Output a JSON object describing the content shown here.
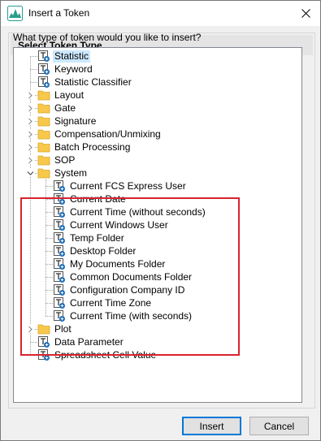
{
  "window": {
    "title": "Insert a Token"
  },
  "group": {
    "header": "Select Token Type",
    "question": "What type of token would you like to insert?"
  },
  "tree": {
    "items": [
      {
        "label": "Statistic",
        "kind": "token",
        "level": 0,
        "selected": true
      },
      {
        "label": "Keyword",
        "kind": "token",
        "level": 0
      },
      {
        "label": "Statistic Classifier",
        "kind": "token",
        "level": 0
      },
      {
        "label": "Layout",
        "kind": "folder",
        "level": 0,
        "expanded": false
      },
      {
        "label": "Gate",
        "kind": "folder",
        "level": 0,
        "expanded": false
      },
      {
        "label": "Signature",
        "kind": "folder",
        "level": 0,
        "expanded": false
      },
      {
        "label": "Compensation/Unmixing",
        "kind": "folder",
        "level": 0,
        "expanded": false
      },
      {
        "label": "Batch Processing",
        "kind": "folder",
        "level": 0,
        "expanded": false
      },
      {
        "label": "SOP",
        "kind": "folder",
        "level": 0,
        "expanded": false
      },
      {
        "label": "System",
        "kind": "folder",
        "level": 0,
        "expanded": true
      },
      {
        "label": "Current FCS Express User",
        "kind": "token",
        "level": 1
      },
      {
        "label": "Current Date",
        "kind": "token",
        "level": 1
      },
      {
        "label": "Current Time (without seconds)",
        "kind": "token",
        "level": 1
      },
      {
        "label": "Current Windows User",
        "kind": "token",
        "level": 1
      },
      {
        "label": "Temp Folder",
        "kind": "token",
        "level": 1
      },
      {
        "label": "Desktop Folder",
        "kind": "token",
        "level": 1
      },
      {
        "label": "My Documents Folder",
        "kind": "token",
        "level": 1
      },
      {
        "label": "Common Documents Folder",
        "kind": "token",
        "level": 1
      },
      {
        "label": "Configuration Company ID",
        "kind": "token",
        "level": 1
      },
      {
        "label": "Current Time Zone",
        "kind": "token",
        "level": 1
      },
      {
        "label": "Current Time (with seconds)",
        "kind": "token",
        "level": 1
      },
      {
        "label": "Plot",
        "kind": "folder",
        "level": 0,
        "expanded": false
      },
      {
        "label": "Data Parameter",
        "kind": "token",
        "level": 0
      },
      {
        "label": "Spreadsheet Cell Value",
        "kind": "token",
        "level": 0
      }
    ]
  },
  "buttons": {
    "insert": "Insert",
    "cancel": "Cancel"
  },
  "colors": {
    "selection": "#cce8ff",
    "highlight_box": "#d9232e",
    "folder": "#f8c84a",
    "token_icon": "#1e6fb8"
  },
  "icons": {
    "app": "flow-cytometry-app-icon",
    "close": "close-icon",
    "token": "token-icon",
    "folder": "folder-icon",
    "collapsed": "chevron-right-icon",
    "expanded": "chevron-down-icon"
  }
}
